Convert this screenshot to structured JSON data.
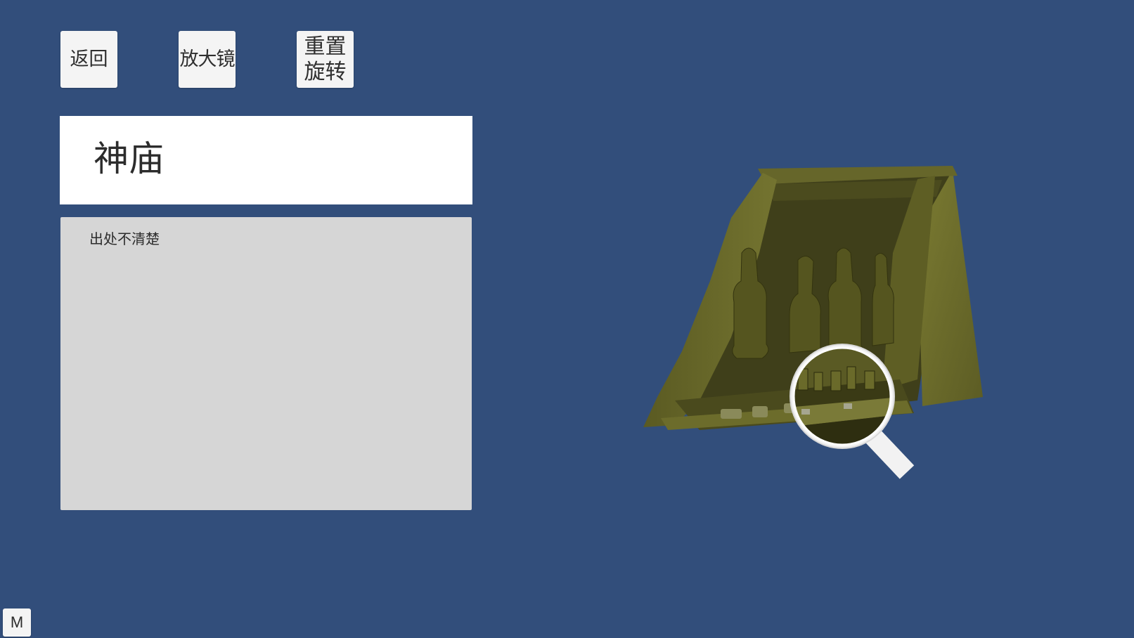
{
  "toolbar": {
    "back_label": "返回",
    "magnifier_label": "放大镜",
    "reset_rotation_label": "重置\n旋转"
  },
  "info": {
    "title": "神庙",
    "description": "出处不清楚"
  },
  "viewer": {
    "model_icon": "temple-3d-model",
    "magnifier_icon": "magnifier-lens-icon"
  },
  "corner_button": {
    "label": "M"
  },
  "colors": {
    "background": "#324e7b",
    "button": "#f4f4f4",
    "title_panel": "#ffffff",
    "description_panel": "#d6d6d6",
    "model": "#6b6b2a"
  }
}
